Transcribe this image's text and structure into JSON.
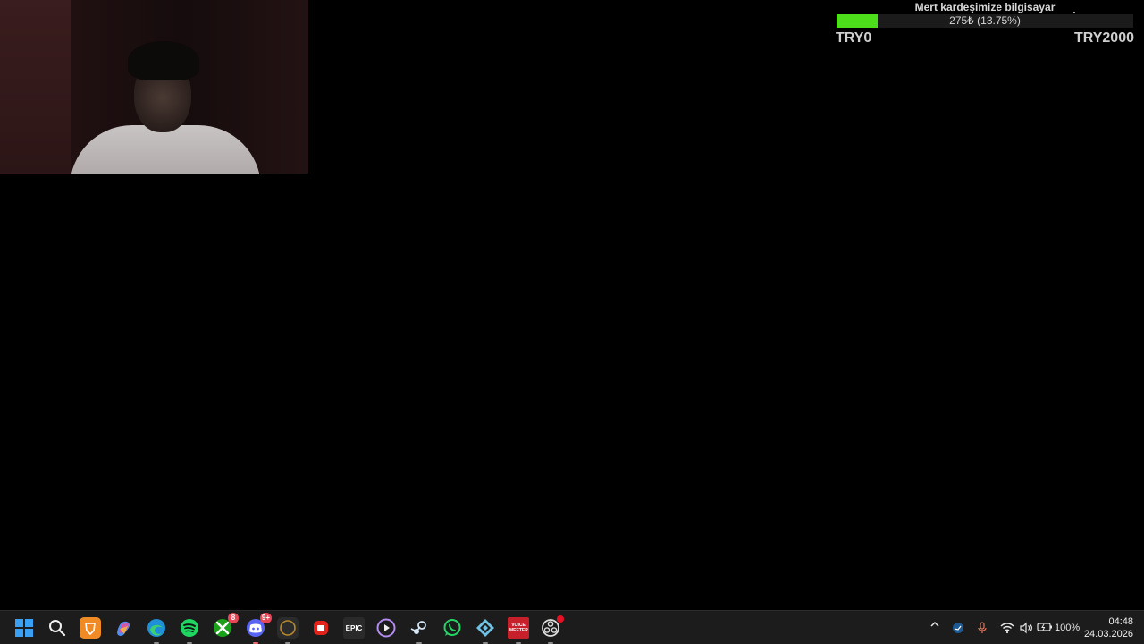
{
  "goal": {
    "title": "Mert kardeşimize bilgisayar",
    "progress_text": "275₺ (13.75%)",
    "fraction": 0.1375,
    "min_label": "TRY0",
    "max_label": "TRY2000",
    "fill_color": "#4de01a"
  },
  "taskbar": {
    "icons": [
      {
        "name": "start-icon",
        "color": "#3aa0f3"
      },
      {
        "name": "search-icon"
      },
      {
        "name": "brave-icon",
        "color": "#f08a24"
      },
      {
        "name": "copilot-icon"
      },
      {
        "name": "edge-icon"
      },
      {
        "name": "spotify-icon",
        "color": "#1ed760"
      },
      {
        "name": "xbox-icon",
        "color": "#1aa11a",
        "badge": "8"
      },
      {
        "name": "discord-icon",
        "color": "#5865f2",
        "badge": "9+"
      },
      {
        "name": "overwolf-icon"
      },
      {
        "name": "roblox-icon",
        "color": "#e2231a"
      },
      {
        "name": "epic-games-icon",
        "glyph": "EPIC"
      },
      {
        "name": "media-player-icon"
      },
      {
        "name": "steam-icon"
      },
      {
        "name": "whatsapp-icon",
        "color": "#25d366"
      },
      {
        "name": "kodi-icon"
      },
      {
        "name": "voicemeeter-icon",
        "glyph": "VOICE MEETER",
        "color": "#c8202a"
      },
      {
        "name": "obs-icon"
      }
    ],
    "tray": {
      "battery": "100%",
      "time": "04:48",
      "date": "24.03.2026"
    }
  }
}
